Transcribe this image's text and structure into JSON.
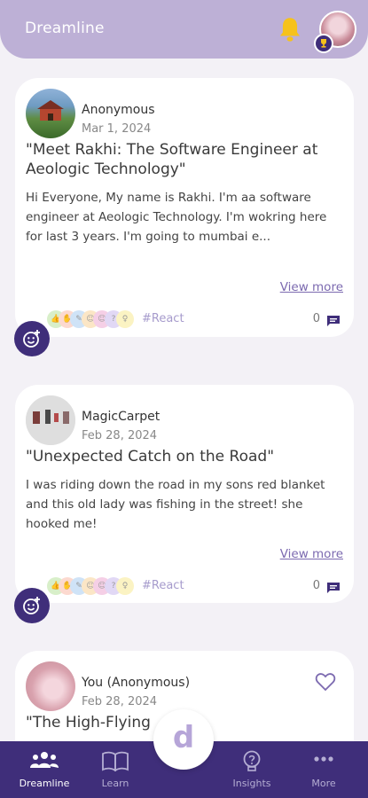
{
  "header": {
    "title": "Dreamline"
  },
  "posts": [
    {
      "user": "Anonymous",
      "date": "Mar 1, 2024",
      "title": "\"Meet Rakhi: The Software Engineer at Aeologic Technology\"",
      "body": "Hi Everyone, My name is Rakhi. I'm aa software engineer at Aeologic Technology. I'm wokring here for last 3 years. I'm going to mumbai e...",
      "view_more": "View more",
      "tag": "#React",
      "comments": "0"
    },
    {
      "user": "MagicCarpet",
      "date": "Feb 28, 2024",
      "title": "\"Unexpected Catch on the Road\"",
      "body": "I was riding down the road in my sons red blanket and this old lady was fishing in the street!  she hooked me!",
      "view_more": "View more",
      "tag": "#React",
      "comments": "0"
    },
    {
      "user": "You (Anonymous)",
      "date": "Feb 28, 2024",
      "title": "\"The High-Flying"
    }
  ],
  "reaction_colors": [
    "#d8efc9",
    "#fcd9cf",
    "#cfe3f7",
    "#fbe6c6",
    "#f5cfe6",
    "#e1d8f5",
    "#fbf3c3"
  ],
  "nav": {
    "items": [
      {
        "label": "Dreamline",
        "icon": "people-icon",
        "active": true
      },
      {
        "label": "Learn",
        "icon": "book-icon",
        "active": false
      },
      {
        "label": "Insights",
        "icon": "lightbulb-icon",
        "active": false
      },
      {
        "label": "More",
        "icon": "dots-icon",
        "active": false
      }
    ],
    "center_letter": "d"
  },
  "colors": {
    "primary": "#3f2e7a",
    "header": "#bdb0d6",
    "accent": "#7c6ab0"
  }
}
